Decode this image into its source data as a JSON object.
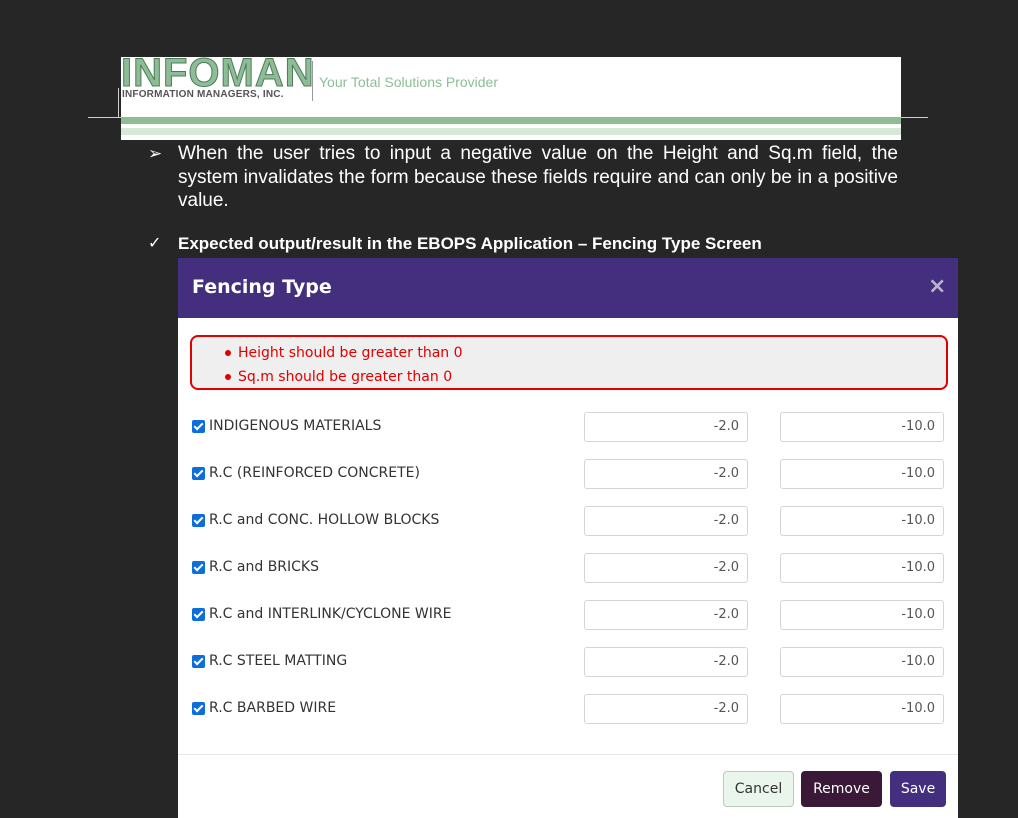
{
  "banner": {
    "logo_word": "INFOMAN",
    "logo_sub": "INFORMATION MANAGERS, INC.",
    "tagline": "Your Total Solutions Provider"
  },
  "document": {
    "paragraph": "When the user tries to input a negative value on the Height and Sq.m field, the system invalidates the form because these fields require and can only be in a positive value.",
    "heading": "Expected output/result in the EBOPS Application – Fencing Type Screen",
    "bullet_icon_1": "arrow-bullet-icon",
    "bullet_icon_2": "check-bullet-icon"
  },
  "modal": {
    "title": "Fencing Type",
    "close_glyph": "×",
    "errors": [
      "Height should be greater than 0",
      "Sq.m should be greater than 0"
    ],
    "rows": [
      {
        "label": "INDIGENOUS MATERIALS",
        "checked": true,
        "height": "-2.0",
        "sqm": "-10.0"
      },
      {
        "label": "R.C (REINFORCED CONCRETE)",
        "checked": true,
        "height": "-2.0",
        "sqm": "-10.0"
      },
      {
        "label": "R.C and CONC. HOLLOW BLOCKS",
        "checked": true,
        "height": "-2.0",
        "sqm": "-10.0"
      },
      {
        "label": "R.C and BRICKS",
        "checked": true,
        "height": "-2.0",
        "sqm": "-10.0"
      },
      {
        "label": "R.C and INTERLINK/CYCLONE WIRE",
        "checked": true,
        "height": "-2.0",
        "sqm": "-10.0"
      },
      {
        "label": "R.C STEEL MATTING",
        "checked": true,
        "height": "-2.0",
        "sqm": "-10.0"
      },
      {
        "label": "R.C BARBED WIRE",
        "checked": true,
        "height": "-2.0",
        "sqm": "-10.0"
      }
    ],
    "buttons": {
      "cancel": "Cancel",
      "remove": "Remove",
      "save": "Save"
    }
  },
  "colors": {
    "page_bg": "#262626",
    "modal_header": "#432f7e",
    "error_red": "#e00000",
    "remove_button": "#3a1838",
    "logo_green": "#8dbd97"
  }
}
